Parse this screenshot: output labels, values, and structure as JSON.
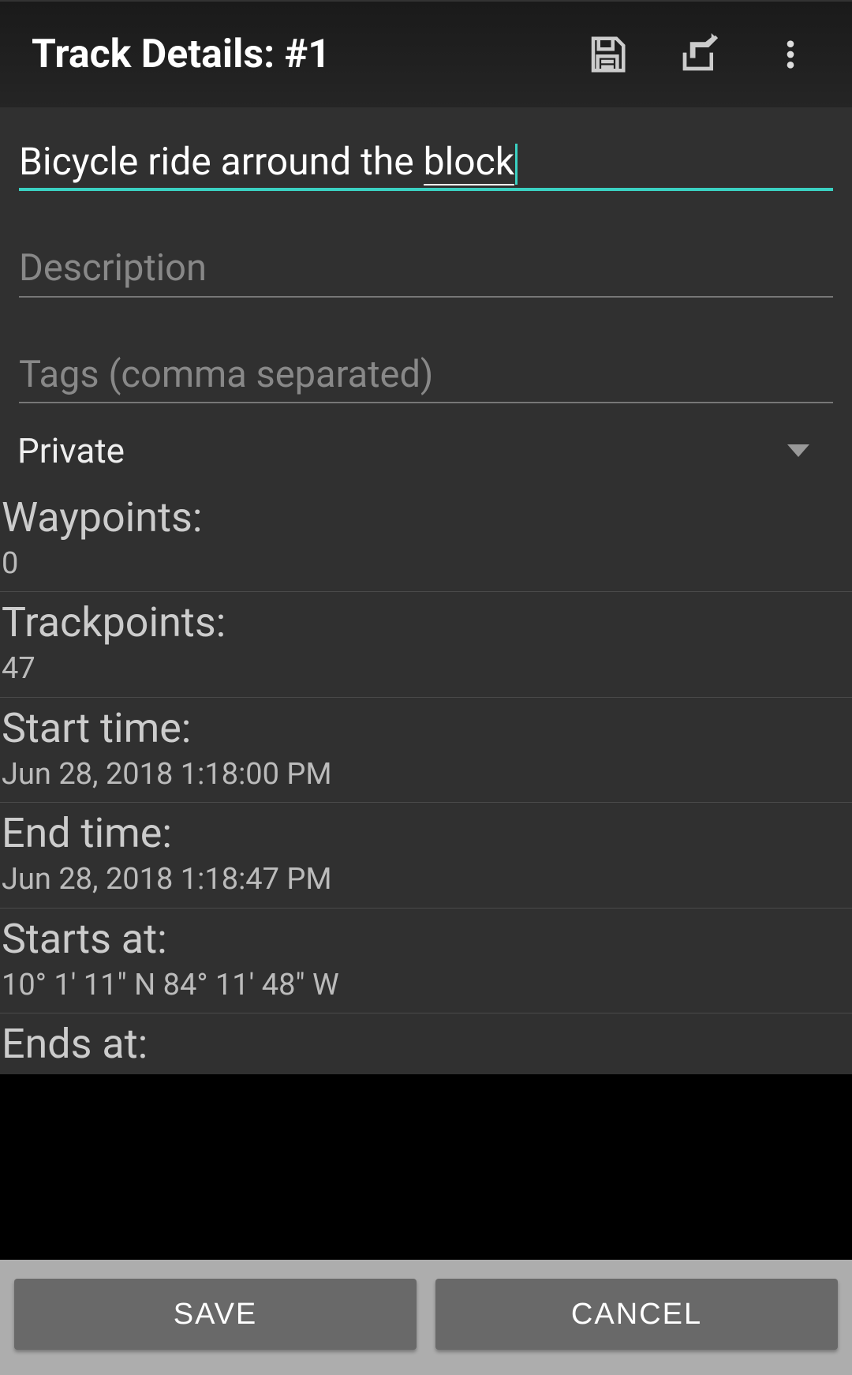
{
  "appbar": {
    "title": "Track Details: #1"
  },
  "fields": {
    "title_value_prefix": "Bicycle ride arround the ",
    "title_value_underlined": "block",
    "description_placeholder": "Description",
    "description_value": "",
    "tags_placeholder": "Tags (comma separated)",
    "tags_value": ""
  },
  "visibility": {
    "selected": "Private"
  },
  "info": {
    "waypoints_label": "Waypoints:",
    "waypoints_value": "0",
    "trackpoints_label": "Trackpoints:",
    "trackpoints_value": "47",
    "start_time_label": "Start time:",
    "start_time_value": "Jun 28, 2018 1:18:00 PM",
    "end_time_label": "End time:",
    "end_time_value": "Jun 28, 2018 1:18:47 PM",
    "starts_at_label": "Starts at:",
    "starts_at_value": "10° 1' 11\" N  84° 11' 48\" W",
    "ends_at_label": "Ends at:"
  },
  "footer": {
    "save_label": "SAVE",
    "cancel_label": "CANCEL"
  }
}
